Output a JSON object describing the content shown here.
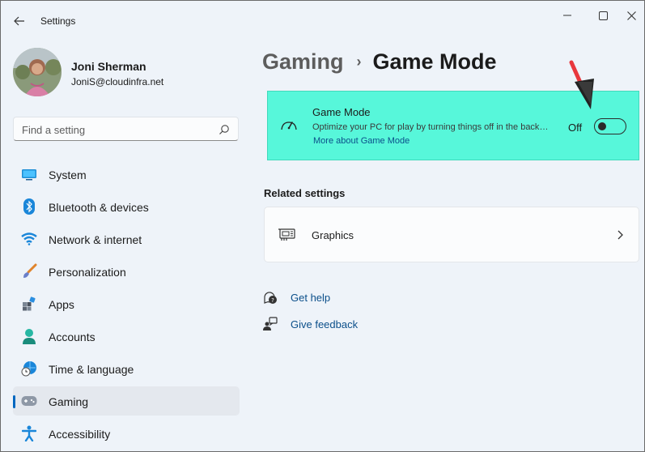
{
  "window": {
    "title": "Settings",
    "back_icon": "back-arrow-icon",
    "controls": [
      "minimize-icon",
      "maximize-icon",
      "close-icon"
    ]
  },
  "profile": {
    "name": "Joni Sherman",
    "email": "JoniS@cloudinfra.net"
  },
  "search": {
    "placeholder": "Find a setting",
    "value": ""
  },
  "sidebar": {
    "items": [
      {
        "label": "System",
        "icon": "system-icon",
        "selected": false
      },
      {
        "label": "Bluetooth & devices",
        "icon": "bluetooth-icon",
        "selected": false
      },
      {
        "label": "Network & internet",
        "icon": "wifi-icon",
        "selected": false
      },
      {
        "label": "Personalization",
        "icon": "brush-icon",
        "selected": false
      },
      {
        "label": "Apps",
        "icon": "apps-icon",
        "selected": false
      },
      {
        "label": "Accounts",
        "icon": "accounts-icon",
        "selected": false
      },
      {
        "label": "Time & language",
        "icon": "time-language-icon",
        "selected": false
      },
      {
        "label": "Gaming",
        "icon": "gamepad-icon",
        "selected": true
      },
      {
        "label": "Accessibility",
        "icon": "accessibility-icon",
        "selected": false
      }
    ]
  },
  "breadcrumb": {
    "parent": "Gaming",
    "separator": "›",
    "current": "Game Mode"
  },
  "game_mode": {
    "title": "Game Mode",
    "description": "Optimize your PC for play by turning things off in the background",
    "link": "More about Game Mode",
    "state_label": "Off",
    "enabled": false,
    "highlight_color": "#57f7da"
  },
  "related": {
    "title": "Related settings",
    "items": [
      {
        "label": "Graphics",
        "icon": "graphics-card-icon"
      }
    ]
  },
  "help": {
    "get_help": "Get help",
    "give_feedback": "Give feedback"
  },
  "colors": {
    "accent": "#0067c0",
    "annotation_arrow": "#e8373d"
  }
}
